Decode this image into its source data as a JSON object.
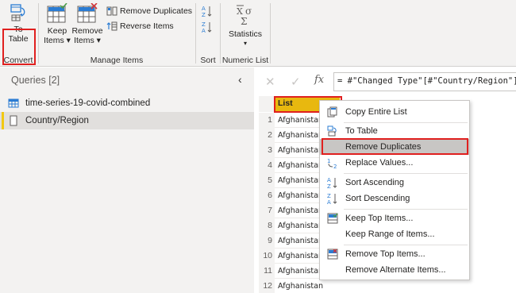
{
  "ribbon": {
    "to_table_line1": "To",
    "to_table_line2": "Table",
    "convert_group": "Convert",
    "keep_items_line1": "Keep",
    "keep_items_line2": "Items ▾",
    "remove_items_line1": "Remove",
    "remove_items_line2": "Items ▾",
    "remove_duplicates": "Remove Duplicates",
    "reverse_items": "Reverse Items",
    "manage_items_group": "Manage Items",
    "sort_group": "Sort",
    "statistics_label": "Statistics",
    "statistics_arrow": "▾",
    "numeric_list_group": "Numeric List"
  },
  "queries": {
    "title": "Queries [2]",
    "collapse_glyph": "‹",
    "items": [
      {
        "label": "time-series-19-covid-combined",
        "icon": "table-icon"
      },
      {
        "label": "Country/Region",
        "icon": "list-icon"
      }
    ]
  },
  "formula_bar": {
    "cancel": "✕",
    "confirm": "✓",
    "fx": "fx",
    "text": "= #\"Changed Type\"[#\"Country/Region\"]"
  },
  "grid": {
    "header": "List",
    "rows": [
      {
        "n": "1",
        "v": "Afghanistan"
      },
      {
        "n": "2",
        "v": "Afghanistan"
      },
      {
        "n": "3",
        "v": "Afghanistan"
      },
      {
        "n": "4",
        "v": "Afghanistan"
      },
      {
        "n": "5",
        "v": "Afghanistan"
      },
      {
        "n": "6",
        "v": "Afghanistan"
      },
      {
        "n": "7",
        "v": "Afghanistan"
      },
      {
        "n": "8",
        "v": "Afghanistan"
      },
      {
        "n": "9",
        "v": "Afghanistan"
      },
      {
        "n": "10",
        "v": "Afghanistan"
      },
      {
        "n": "11",
        "v": "Afghanistan"
      },
      {
        "n": "12",
        "v": "Afghanistan"
      }
    ]
  },
  "context_menu": {
    "items": [
      {
        "label": "Copy Entire List",
        "icon": "copy-icon"
      },
      {
        "label": "To Table",
        "icon": "to-table-icon"
      },
      {
        "label": "Remove Duplicates",
        "icon": "none"
      },
      {
        "label": "Replace Values...",
        "icon": "replace-icon"
      },
      {
        "label": "Sort Ascending",
        "icon": "sort-ascending-icon"
      },
      {
        "label": "Sort Descending",
        "icon": "sort-descending-icon"
      },
      {
        "label": "Keep Top Items...",
        "icon": "keep-top-icon"
      },
      {
        "label": "Keep Range of Items...",
        "icon": "none"
      },
      {
        "label": "Remove Top Items...",
        "icon": "remove-top-icon"
      },
      {
        "label": "Remove Alternate Items...",
        "icon": "none"
      }
    ]
  },
  "colors": {
    "highlight": "#e0201f",
    "list_header": "#e8b80f",
    "selected_bar": "#f2c811",
    "icon_blue": "#2b7cd3"
  }
}
